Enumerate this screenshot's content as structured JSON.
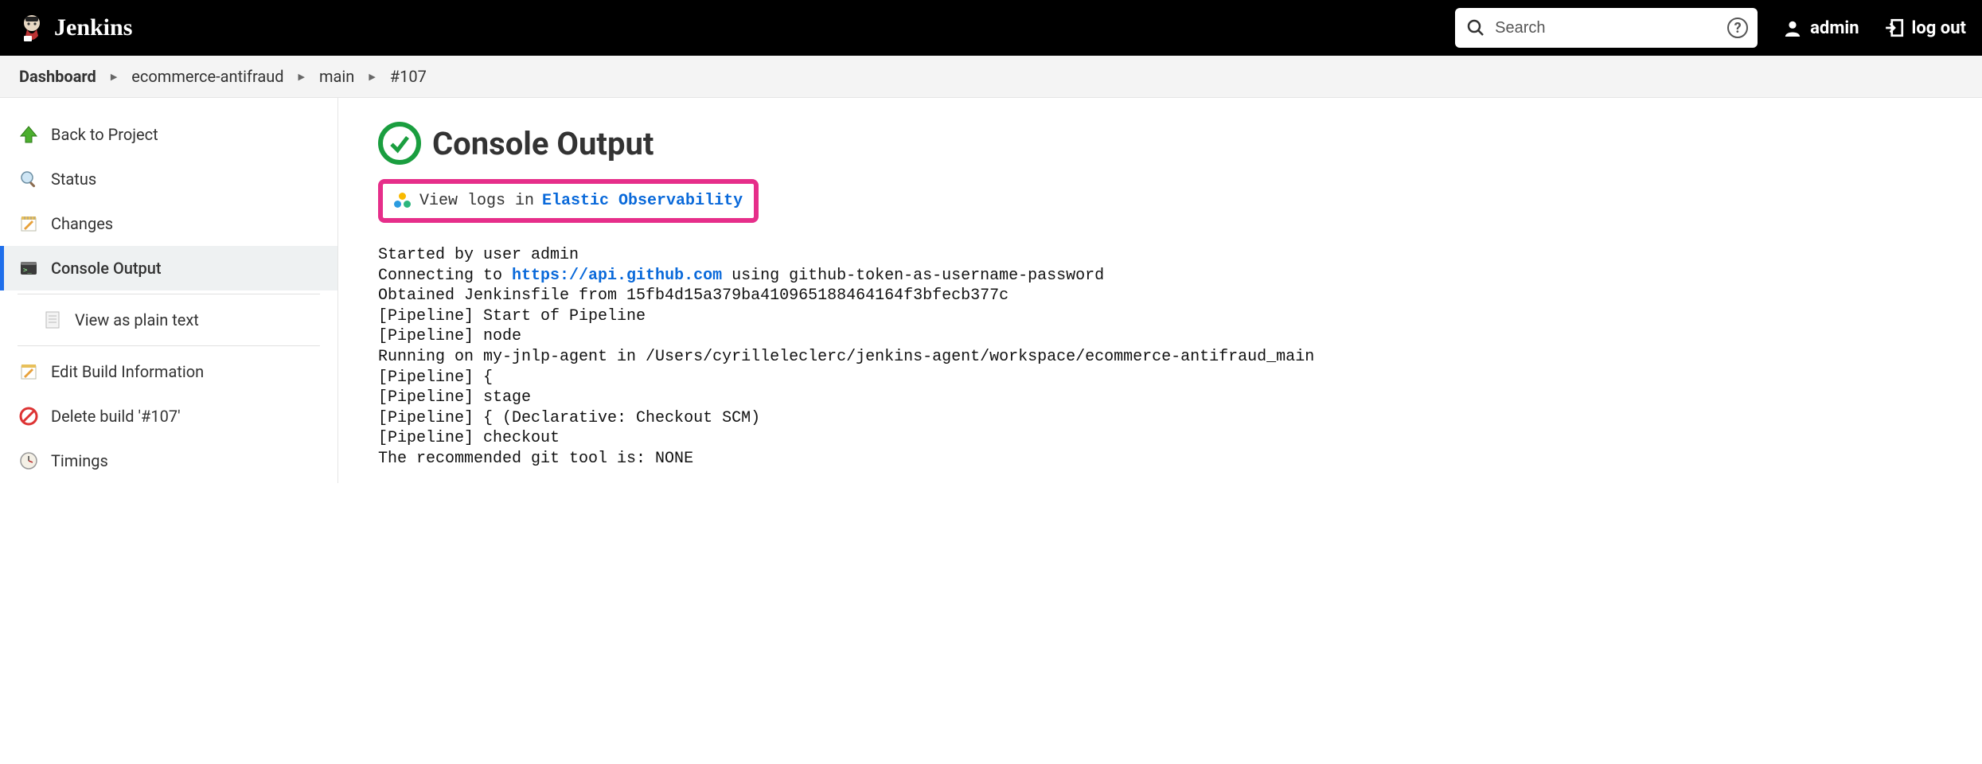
{
  "header": {
    "brand": "Jenkins",
    "search_placeholder": "Search",
    "user_label": "admin",
    "logout_label": "log out"
  },
  "breadcrumbs": [
    "Dashboard",
    "ecommerce-antifraud",
    "main",
    "#107"
  ],
  "sidebar": {
    "back": "Back to Project",
    "status": "Status",
    "changes": "Changes",
    "console": "Console Output",
    "plain": "View as plain text",
    "edit": "Edit Build Information",
    "delete": "Delete build '#107'",
    "timings": "Timings"
  },
  "page": {
    "title": "Console Output",
    "banner_prefix": "View logs in ",
    "banner_link": "Elastic Observability"
  },
  "console": {
    "line1_a": "Started by user admin",
    "line2_a": "Connecting to ",
    "line2_link": "https://api.github.com",
    "line2_b": " using github-token-as-username-password",
    "line3": "Obtained Jenkinsfile from 15fb4d15a379ba410965188464164f3bfecb377c",
    "line4": "[Pipeline] Start of Pipeline",
    "line5": "[Pipeline] node",
    "line6": "Running on my-jnlp-agent in /Users/cyrilleleclerc/jenkins-agent/workspace/ecommerce-antifraud_main",
    "line7": "[Pipeline] {",
    "line8": "[Pipeline] stage",
    "line9": "[Pipeline] { (Declarative: Checkout SCM)",
    "line10": "[Pipeline] checkout",
    "line11": "The recommended git tool is: NONE"
  }
}
